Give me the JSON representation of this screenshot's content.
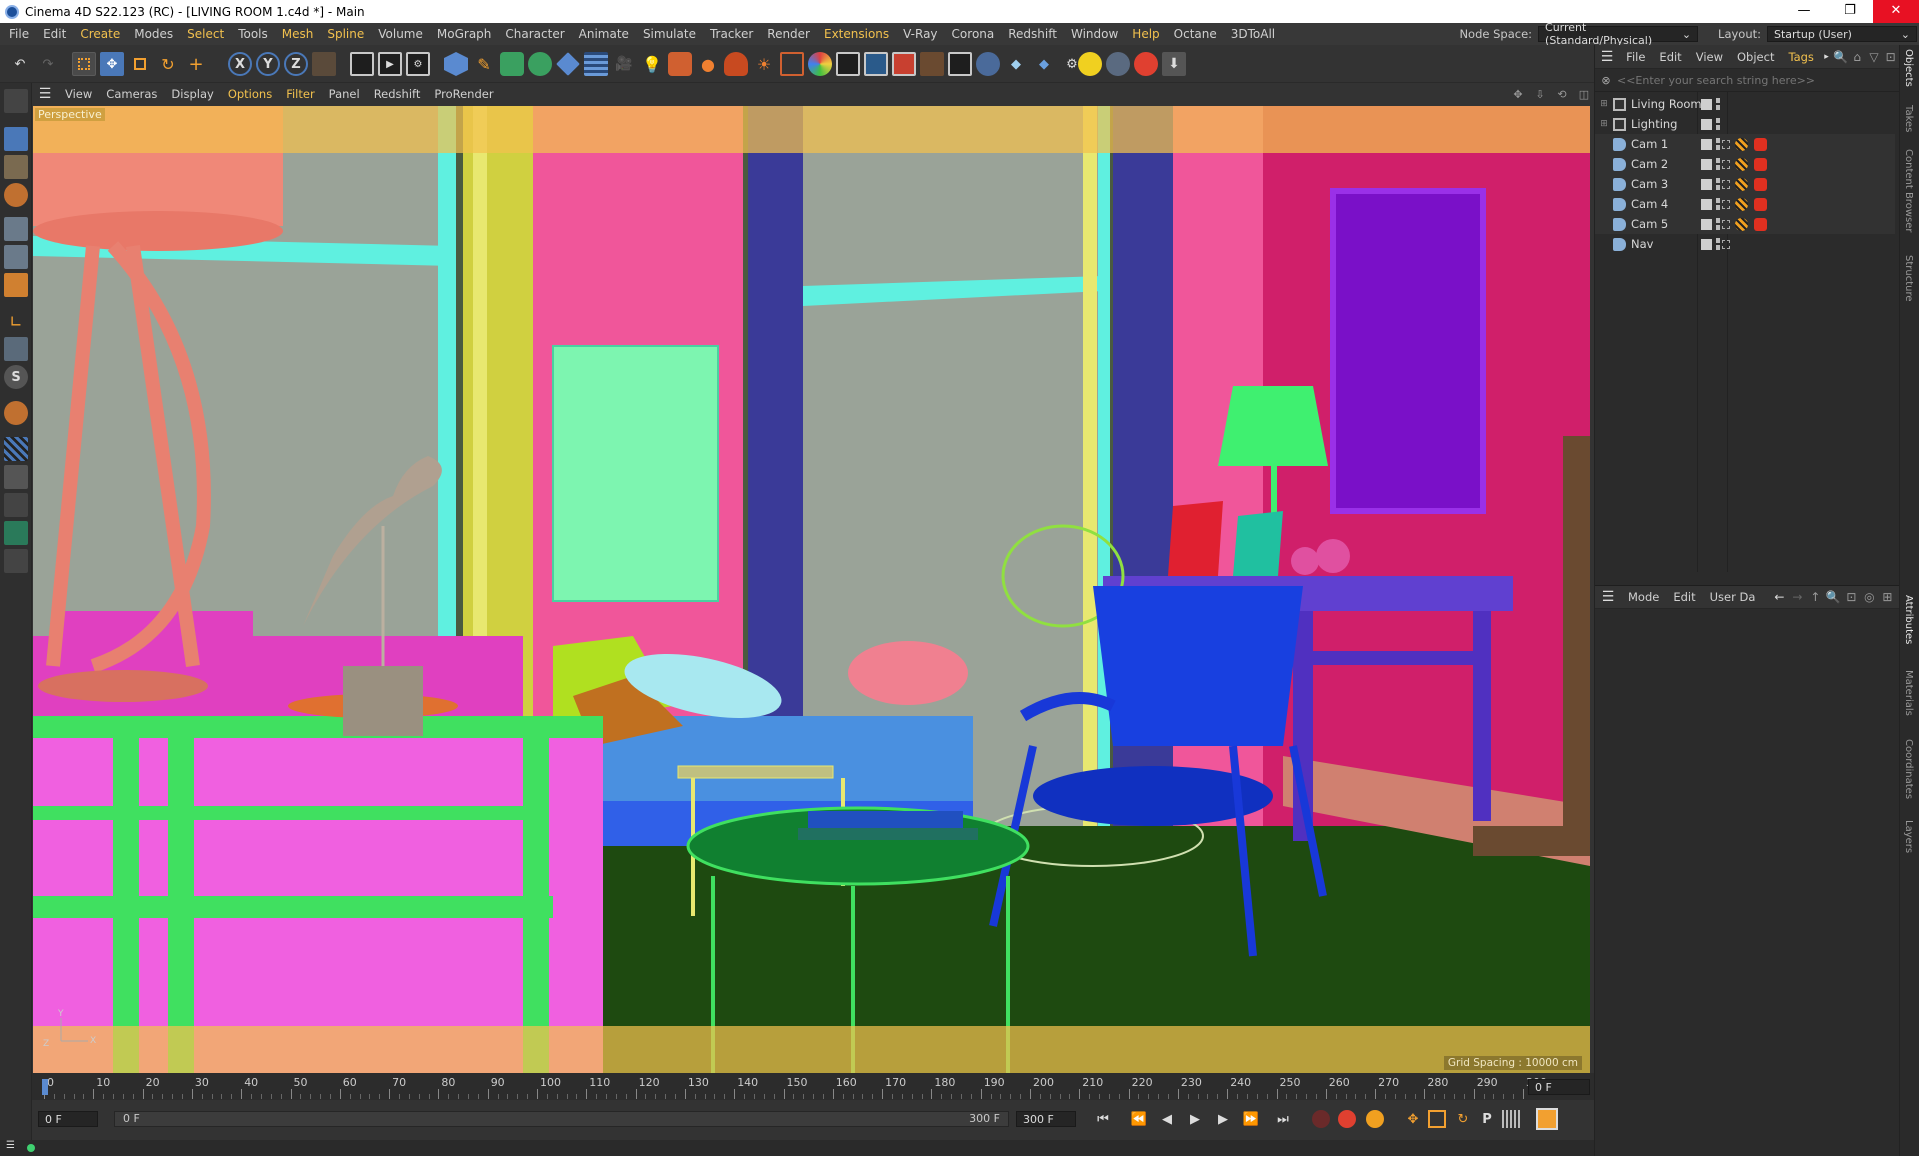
{
  "window": {
    "title": "Cinema 4D S22.123 (RC) - [LIVING ROOM 1.c4d *] - Main",
    "minimize": "—",
    "restore": "❐",
    "close": "✕"
  },
  "menubar": {
    "items": [
      "File",
      "Edit",
      "Create",
      "Modes",
      "Select",
      "Tools",
      "Mesh",
      "Spline",
      "Volume",
      "MoGraph",
      "Character",
      "Animate",
      "Simulate",
      "Tracker",
      "Render",
      "Extensions",
      "V-Ray",
      "Corona",
      "Redshift",
      "Window",
      "Help",
      "Octane",
      "3DToAll"
    ],
    "highlighted": [
      "Create",
      "Select",
      "Mesh",
      "Spline",
      "Extensions",
      "Help"
    ],
    "node_space_label": "Node Space:",
    "node_space_value": "Current (Standard/Physical)",
    "layout_label": "Layout:",
    "layout_value": "Startup (User)"
  },
  "viewport": {
    "menu": [
      "View",
      "Cameras",
      "Display",
      "Options",
      "Filter",
      "Panel",
      "Redshift",
      "ProRender"
    ],
    "highlighted": [
      "Options",
      "Filter"
    ],
    "label": "Perspective",
    "grid_spacing": "Grid Spacing : 10000 cm",
    "axis_z": "Z",
    "axis_x": "X",
    "axis_y": "Y"
  },
  "timeline": {
    "ticks": [
      "0",
      "10",
      "20",
      "30",
      "40",
      "50",
      "60",
      "70",
      "80",
      "90",
      "100",
      "110",
      "120",
      "130",
      "140",
      "150",
      "160",
      "170",
      "180",
      "190",
      "200",
      "210",
      "220",
      "230",
      "240",
      "250",
      "260",
      "270",
      "280",
      "290",
      "300"
    ],
    "current_frame_field": "0 F"
  },
  "transport": {
    "start_field": "0 F",
    "range_start": "0 F",
    "range_end": "300 F",
    "end_field": "300 F"
  },
  "object_manager": {
    "menu": [
      "File",
      "Edit",
      "View",
      "Object",
      "Tags"
    ],
    "highlighted": [
      "Tags"
    ],
    "search_placeholder": "<<Enter your search string here>>",
    "objects": [
      {
        "name": "Living Room",
        "type": "layer",
        "tags": []
      },
      {
        "name": "Lighting",
        "type": "layer",
        "tags": []
      },
      {
        "name": "Cam 1",
        "type": "camera",
        "tags": [
          "protection",
          "target"
        ]
      },
      {
        "name": "Cam 2",
        "type": "camera",
        "tags": [
          "protection",
          "target"
        ]
      },
      {
        "name": "Cam 3",
        "type": "camera",
        "tags": [
          "protection",
          "target"
        ]
      },
      {
        "name": "Cam 4",
        "type": "camera",
        "tags": [
          "protection",
          "target"
        ]
      },
      {
        "name": "Cam 5",
        "type": "camera",
        "tags": [
          "protection",
          "target"
        ]
      },
      {
        "name": "Nav",
        "type": "camera",
        "tags": []
      }
    ]
  },
  "attribute_manager": {
    "menu": [
      "Mode",
      "Edit",
      "User Da"
    ]
  },
  "side_tabs": {
    "top": [
      "Objects",
      "Takes",
      "Content Browser",
      "Structure"
    ],
    "bottom": [
      "Attributes",
      "Materials",
      "Coordinates",
      "Layers"
    ],
    "active": [
      "Objects",
      "Attributes"
    ]
  },
  "colors": {
    "accent": "#f2c14e",
    "panel_bg": "#2b2b2b",
    "toolbar_bg": "#333333",
    "active_blue": "#4a78b8"
  }
}
